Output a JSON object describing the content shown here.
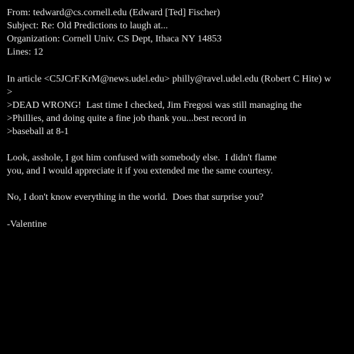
{
  "header": {
    "from": "From: tedward@cs.cornell.edu (Edward [Ted] Fischer)",
    "subject": "Subject: Re: Old Predictions to laugh at...",
    "organization": "Organization: Cornell Univ. CS Dept, Ithaca NY 14853",
    "lines": "Lines: 12"
  },
  "body": {
    "attribution": "In article <C5JCrF.KrM@news.udel.edu> philly@ravel.udel.edu (Robert C Hite) w",
    "quote": [
      ">",
      ">DEAD WRONG!  Last time I checked, Jim Fregosi was still managing the",
      ">Phillies, and doing quite a fine job thank you...best record in",
      ">baseball at 8-1"
    ],
    "reply_paragraph_1": [
      "Look, asshole, I got him confused with somebody else.  I didn't flame",
      "you, and I would appreciate it if you extended me the same courtesy."
    ],
    "reply_paragraph_2": "No, I don't know everything in the world.  Does that surprise you?",
    "signature": "-Valentine"
  },
  "colors": {
    "background": "#000000",
    "text": "#e6e6e6"
  }
}
